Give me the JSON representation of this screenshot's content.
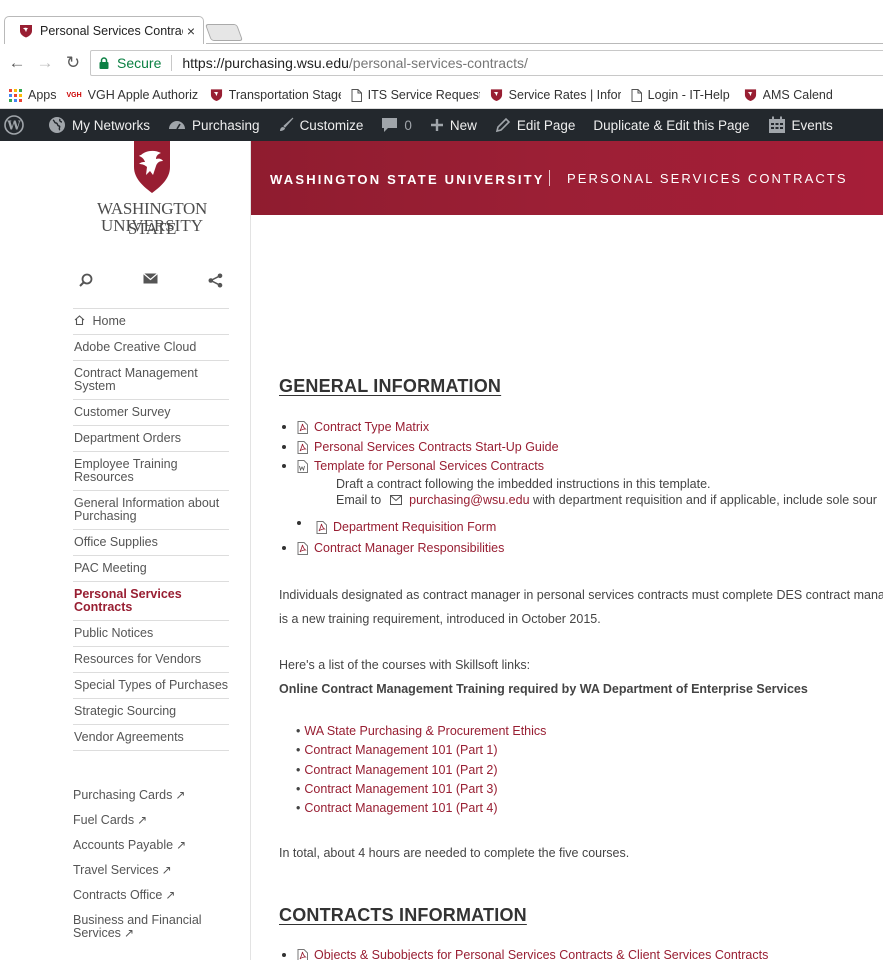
{
  "browser": {
    "tab_title": "Personal Services Contrac",
    "tab_close": "×",
    "secure_label": "Secure",
    "url_host": "https://purchasing.wsu.edu",
    "url_path": "/personal-services-contracts/",
    "bookmarks": [
      {
        "label": "Apps",
        "icon": "apps-grid-icon"
      },
      {
        "label": "VGH Apple Authoriz",
        "icon": "vgh-icon",
        "icon_text": "VGH"
      },
      {
        "label": "Transportation Stage",
        "icon": "wsu-shield-icon"
      },
      {
        "label": "ITS Service Request S",
        "icon": "page-icon"
      },
      {
        "label": "Service Rates | Inform",
        "icon": "wsu-shield-icon"
      },
      {
        "label": "Login - IT-Help",
        "icon": "page-icon"
      },
      {
        "label": "AMS Calend",
        "icon": "wsu-shield-icon"
      }
    ]
  },
  "adminbar": {
    "items": [
      {
        "label": "",
        "icon": "wordpress-icon"
      },
      {
        "label": "My Networks",
        "icon": "globe-icon"
      },
      {
        "label": "Purchasing",
        "icon": "dashboard-icon"
      },
      {
        "label": "Customize",
        "icon": "brush-icon"
      },
      {
        "label": "0",
        "icon": "comment-icon"
      },
      {
        "label": "New",
        "icon": "plus-icon"
      },
      {
        "label": "Edit Page",
        "icon": "pencil-icon"
      },
      {
        "label": "Duplicate & Edit this Page",
        "icon": ""
      },
      {
        "label": "Events",
        "icon": "calendar-icon"
      }
    ]
  },
  "sidebar": {
    "logo_line1": "WASHINGTON STATE",
    "logo_line2": "UNIVERSITY",
    "nav": [
      "Home",
      "Adobe Creative Cloud",
      "Contract Management System",
      "Customer Survey",
      "Department Orders",
      "Employee Training Resources",
      "General Information about Purchasing",
      "Office Supplies",
      "PAC Meeting",
      "Personal Services Contracts",
      "Public Notices",
      "Resources for Vendors",
      "Special Types of Purchases",
      "Strategic Sourcing",
      "Vendor Agreements"
    ],
    "active_index": 9,
    "external": [
      "Purchasing Cards",
      "Fuel Cards",
      "Accounts Payable",
      "Travel Services",
      "Contracts Office",
      "Business and Financial Services"
    ]
  },
  "header": {
    "university": "WASHINGTON STATE UNIVERSITY",
    "site": "PERSONAL SERVICES CONTRACTS"
  },
  "main": {
    "general_heading": "GENERAL INFORMATION",
    "general_links": [
      "Contract Type Matrix",
      "Personal Services Contracts Start-Up Guide",
      "Template for Personal Services Contracts",
      "Department Requisition Form",
      "Contract Manager Responsibilities"
    ],
    "template_note": "Draft a contract following the imbedded instructions in this template.",
    "email_prefix": "Email to",
    "email": "purchasing@wsu.edu",
    "email_suffix": "with department requisition and if applicable, include sole sour",
    "para1_line1": "Individuals designated as contract manager in personal services contracts must complete DES contract mana",
    "para1_line2": "is a new training requirement, introduced in October 2015.",
    "para2": "Here's a list of the courses with Skillsoft links:",
    "para3": "Online Contract Management Training required by WA Department of Enterprise Services",
    "courses": [
      "WA State Purchasing & Procurement Ethics",
      "Contract Management 101 (Part 1)",
      "Contract Management 101 (Part 2)",
      "Contract Management 101 (Part 3)",
      "Contract Management 101 (Part 4)"
    ],
    "para4": "In total, about 4 hours are needed to complete the five courses.",
    "contracts_heading": "CONTRACTS INFORMATION",
    "contracts_links": [
      "Objects & Subobjects for Personal Services Contracts & Client Services Contracts"
    ]
  },
  "colors": {
    "crimson": "#981e32",
    "admin_bar": "#23282d",
    "secure_green": "#0b8043"
  }
}
